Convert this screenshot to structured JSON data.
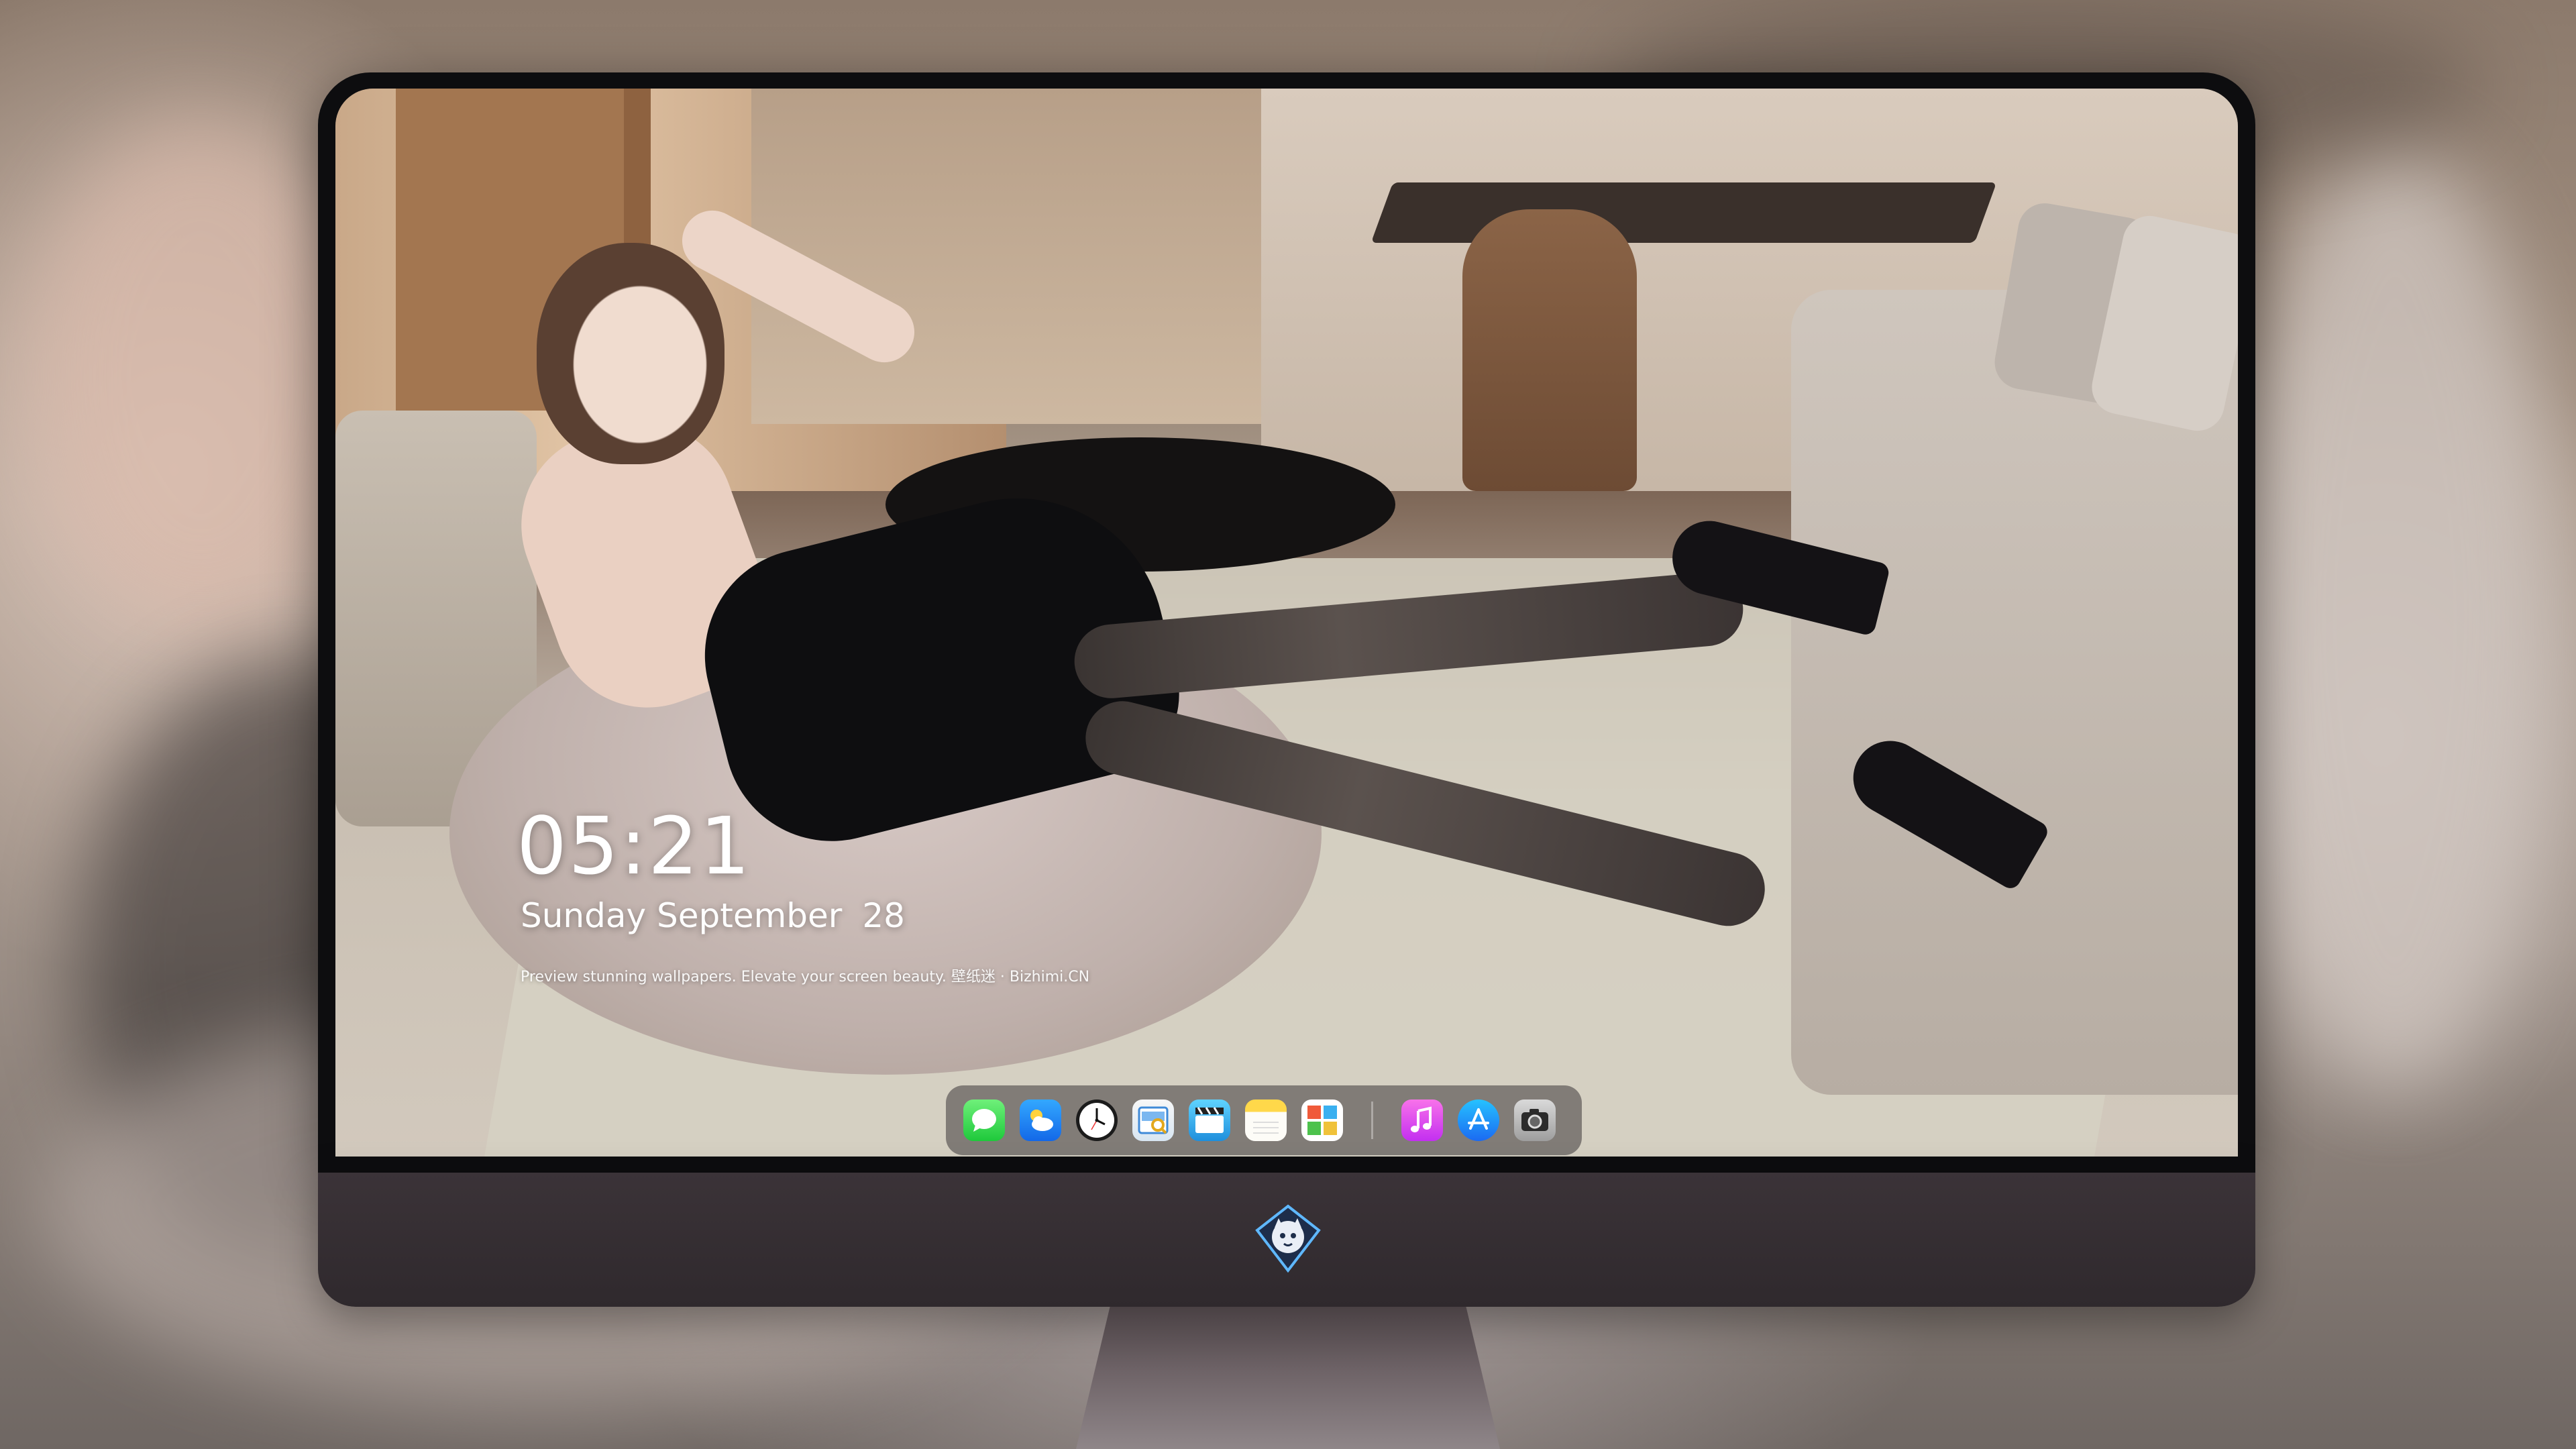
{
  "lockscreen": {
    "time": "05:21",
    "date_weekday_month": "Sunday September",
    "date_day": "28",
    "tagline": "Preview stunning wallpapers. Elevate your screen beauty. 壁纸迷 · Bizhimi.CN"
  },
  "dock": {
    "apps": [
      {
        "name": "messages",
        "icon": "message-bubble-icon"
      },
      {
        "name": "weather",
        "icon": "cloud-sun-icon"
      },
      {
        "name": "clock",
        "icon": "clock-icon"
      },
      {
        "name": "preview",
        "icon": "preview-icon"
      },
      {
        "name": "claquette",
        "icon": "clapperboard-icon"
      },
      {
        "name": "notes",
        "icon": "notes-icon"
      },
      {
        "name": "photos",
        "icon": "photos-icon"
      }
    ],
    "pinned": [
      {
        "name": "music",
        "icon": "music-note-icon"
      },
      {
        "name": "app-store",
        "icon": "app-store-icon"
      },
      {
        "name": "camera",
        "icon": "camera-icon"
      }
    ]
  },
  "colors": {
    "messages": "#2ad348",
    "weather": "#1f86f2",
    "music": "#e04df0",
    "appstore": "#1f8ff5",
    "chin": "#342d31"
  }
}
